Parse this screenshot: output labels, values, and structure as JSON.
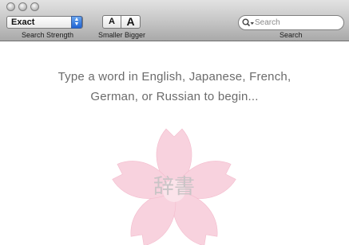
{
  "toolbar": {
    "strength_popup": {
      "value": "Exact"
    },
    "strength_label": "Search Strength",
    "font_small": "A",
    "font_big": "A",
    "size_label": "Smaller Bigger",
    "search_placeholder": "Search",
    "search_label": "Search"
  },
  "main": {
    "prompt_line1": "Type a word in English, Japanese, French,",
    "prompt_line2": "German, or Russian to begin...",
    "logo_text": "辞書"
  },
  "icons": {
    "search": "magnifier-with-dropdown",
    "popup": "up-down-arrows",
    "logo": "cherry-blossom"
  },
  "colors": {
    "accent": "#2a6ddb",
    "prompt_text": "#6b6b6b",
    "blossom": "#f7cdda"
  }
}
